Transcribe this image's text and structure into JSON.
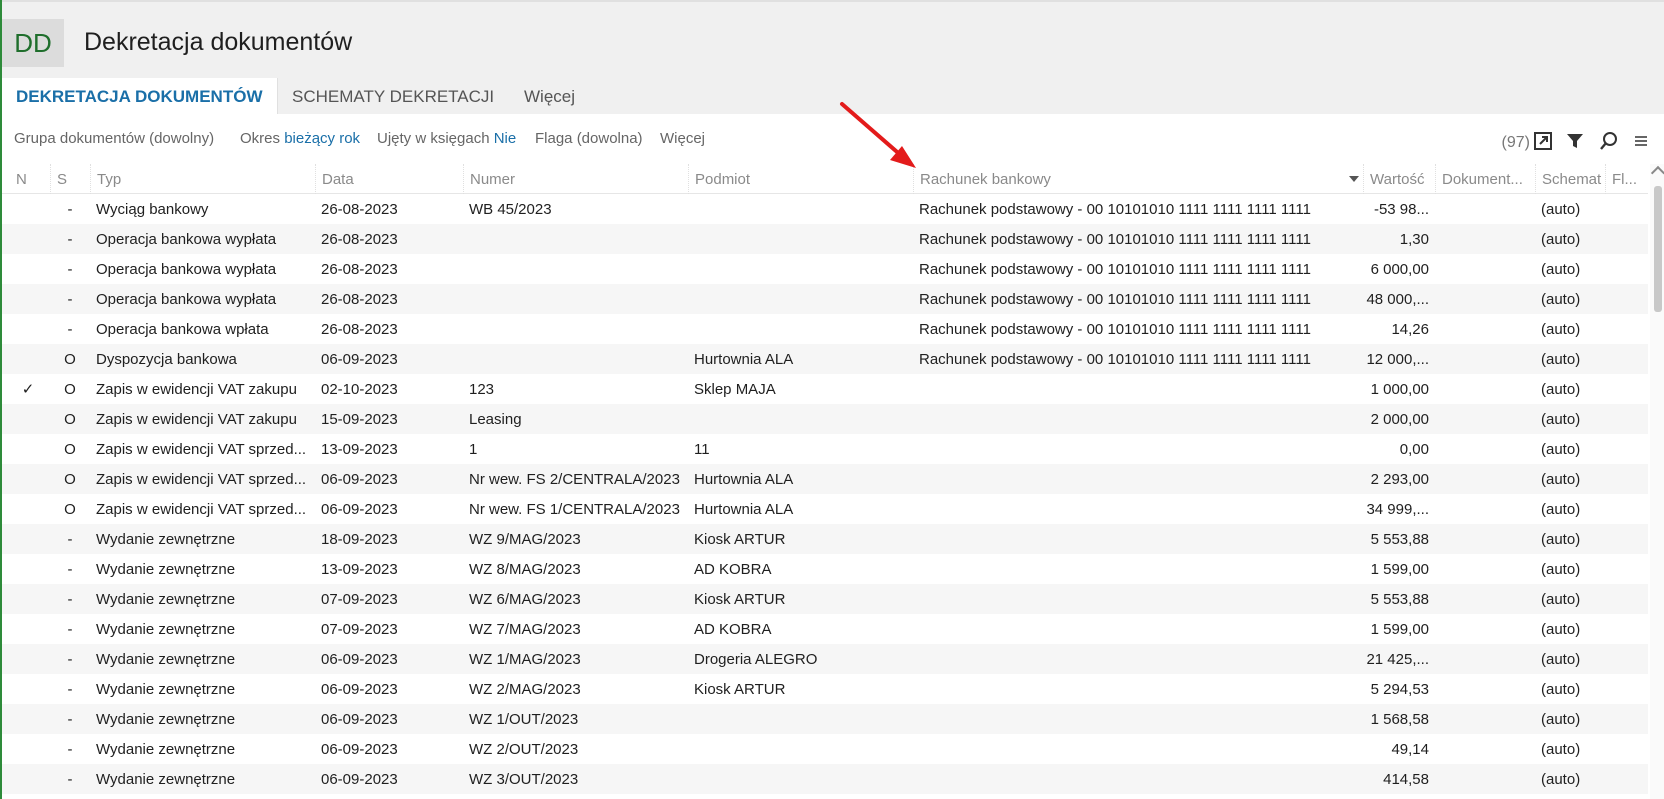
{
  "app": {
    "logo": "DD",
    "title": "Dekretacja dokumentów",
    "accent": "#1a6fa8",
    "brand": "#2e8b3a"
  },
  "tabs": [
    {
      "label": "DEKRETACJA DOKUMENTÓW",
      "active": true
    },
    {
      "label": "SCHEMATY DEKRETACJI",
      "active": false
    },
    {
      "label": "Więcej",
      "active": false
    }
  ],
  "filters": {
    "grupa": "Grupa dokumentów (dowolny)",
    "okres_label": "Okres",
    "okres_value": "bieżący rok",
    "ujety_label": "Ujęty w księgach",
    "ujety_value": "Nie",
    "flaga": "Flaga (dowolna)",
    "wiecej": "Więcej"
  },
  "toolbar": {
    "count": "(97)",
    "icons": [
      "export-icon",
      "filter-icon",
      "search-icon",
      "menu-icon"
    ]
  },
  "columns": {
    "n": "N",
    "s": "S",
    "typ": "Typ",
    "data": "Data",
    "numer": "Numer",
    "podmiot": "Podmiot",
    "rachunek": "Rachunek bankowy",
    "wartosc": "Wartość",
    "dokument": "Dokument...",
    "schemat": "Schemat",
    "fl": "Fl..."
  },
  "rows": [
    {
      "n": "",
      "s": "-",
      "typ": "Wyciąg bankowy",
      "data": "26-08-2023",
      "numer": "WB 45/2023",
      "podmiot": "",
      "rachunek": "Rachunek podstawowy - 00 10101010 1111 1111 1111 1111",
      "wartosc": "-53 98...",
      "dokument": "",
      "schemat": "(auto)"
    },
    {
      "n": "",
      "s": "-",
      "typ": "Operacja bankowa wypłata",
      "data": "26-08-2023",
      "numer": "",
      "podmiot": "",
      "rachunek": "Rachunek podstawowy - 00 10101010 1111 1111 1111 1111",
      "wartosc": "1,30",
      "dokument": "",
      "schemat": "(auto)"
    },
    {
      "n": "",
      "s": "-",
      "typ": "Operacja bankowa wypłata",
      "data": "26-08-2023",
      "numer": "",
      "podmiot": "",
      "rachunek": "Rachunek podstawowy - 00 10101010 1111 1111 1111 1111",
      "wartosc": "6 000,00",
      "dokument": "",
      "schemat": "(auto)"
    },
    {
      "n": "",
      "s": "-",
      "typ": "Operacja bankowa wypłata",
      "data": "26-08-2023",
      "numer": "",
      "podmiot": "",
      "rachunek": "Rachunek podstawowy - 00 10101010 1111 1111 1111 1111",
      "wartosc": "48 000,...",
      "dokument": "",
      "schemat": "(auto)"
    },
    {
      "n": "",
      "s": "-",
      "typ": "Operacja bankowa wpłata",
      "data": "26-08-2023",
      "numer": "",
      "podmiot": "",
      "rachunek": "Rachunek podstawowy - 00 10101010 1111 1111 1111 1111",
      "wartosc": "14,26",
      "dokument": "",
      "schemat": "(auto)"
    },
    {
      "n": "",
      "s": "O",
      "typ": "Dyspozycja bankowa",
      "data": "06-09-2023",
      "numer": "",
      "podmiot": "Hurtownia ALA",
      "rachunek": "Rachunek podstawowy - 00 10101010 1111 1111 1111 1111",
      "wartosc": "12 000,...",
      "dokument": "",
      "schemat": "(auto)"
    },
    {
      "n": "✓",
      "s": "O",
      "typ": "Zapis w ewidencji VAT zakupu",
      "data": "02-10-2023",
      "numer": "123",
      "podmiot": "Sklep MAJA",
      "rachunek": "",
      "wartosc": "1 000,00",
      "dokument": "",
      "schemat": "(auto)"
    },
    {
      "n": "",
      "s": "O",
      "typ": "Zapis w ewidencji VAT zakupu",
      "data": "15-09-2023",
      "numer": "Leasing",
      "podmiot": "",
      "rachunek": "",
      "wartosc": "2 000,00",
      "dokument": "",
      "schemat": "(auto)"
    },
    {
      "n": "",
      "s": "O",
      "typ": "Zapis w ewidencji VAT sprzed...",
      "data": "13-09-2023",
      "numer": "1",
      "podmiot": "11",
      "rachunek": "",
      "wartosc": "0,00",
      "dokument": "",
      "schemat": "(auto)"
    },
    {
      "n": "",
      "s": "O",
      "typ": "Zapis w ewidencji VAT sprzed...",
      "data": "06-09-2023",
      "numer": "Nr wew. FS 2/CENTRALA/2023",
      "podmiot": "Hurtownia ALA",
      "rachunek": "",
      "wartosc": "2 293,00",
      "dokument": "",
      "schemat": "(auto)"
    },
    {
      "n": "",
      "s": "O",
      "typ": "Zapis w ewidencji VAT sprzed...",
      "data": "06-09-2023",
      "numer": "Nr wew. FS 1/CENTRALA/2023",
      "podmiot": "Hurtownia ALA",
      "rachunek": "",
      "wartosc": "34 999,...",
      "dokument": "",
      "schemat": "(auto)"
    },
    {
      "n": "",
      "s": "-",
      "typ": "Wydanie zewnętrzne",
      "data": "18-09-2023",
      "numer": "WZ 9/MAG/2023",
      "podmiot": "Kiosk ARTUR",
      "rachunek": "",
      "wartosc": "5 553,88",
      "dokument": "",
      "schemat": "(auto)"
    },
    {
      "n": "",
      "s": "-",
      "typ": "Wydanie zewnętrzne",
      "data": "13-09-2023",
      "numer": "WZ 8/MAG/2023",
      "podmiot": "AD KOBRA",
      "rachunek": "",
      "wartosc": "1 599,00",
      "dokument": "",
      "schemat": "(auto)"
    },
    {
      "n": "",
      "s": "-",
      "typ": "Wydanie zewnętrzne",
      "data": "07-09-2023",
      "numer": "WZ 6/MAG/2023",
      "podmiot": "Kiosk ARTUR",
      "rachunek": "",
      "wartosc": "5 553,88",
      "dokument": "",
      "schemat": "(auto)"
    },
    {
      "n": "",
      "s": "-",
      "typ": "Wydanie zewnętrzne",
      "data": "07-09-2023",
      "numer": "WZ 7/MAG/2023",
      "podmiot": "AD KOBRA",
      "rachunek": "",
      "wartosc": "1 599,00",
      "dokument": "",
      "schemat": "(auto)"
    },
    {
      "n": "",
      "s": "-",
      "typ": "Wydanie zewnętrzne",
      "data": "06-09-2023",
      "numer": "WZ 1/MAG/2023",
      "podmiot": "Drogeria ALEGRO",
      "rachunek": "",
      "wartosc": "21 425,...",
      "dokument": "",
      "schemat": "(auto)"
    },
    {
      "n": "",
      "s": "-",
      "typ": "Wydanie zewnętrzne",
      "data": "06-09-2023",
      "numer": "WZ 2/MAG/2023",
      "podmiot": "Kiosk ARTUR",
      "rachunek": "",
      "wartosc": "5 294,53",
      "dokument": "",
      "schemat": "(auto)"
    },
    {
      "n": "",
      "s": "-",
      "typ": "Wydanie zewnętrzne",
      "data": "06-09-2023",
      "numer": "WZ 1/OUT/2023",
      "podmiot": "",
      "rachunek": "",
      "wartosc": "1 568,58",
      "dokument": "",
      "schemat": "(auto)"
    },
    {
      "n": "",
      "s": "-",
      "typ": "Wydanie zewnętrzne",
      "data": "06-09-2023",
      "numer": "WZ 2/OUT/2023",
      "podmiot": "",
      "rachunek": "",
      "wartosc": "49,14",
      "dokument": "",
      "schemat": "(auto)"
    },
    {
      "n": "",
      "s": "-",
      "typ": "Wydanie zewnętrzne",
      "data": "06-09-2023",
      "numer": "WZ 3/OUT/2023",
      "podmiot": "",
      "rachunek": "",
      "wartosc": "414,58",
      "dokument": "",
      "schemat": "(auto)"
    }
  ]
}
